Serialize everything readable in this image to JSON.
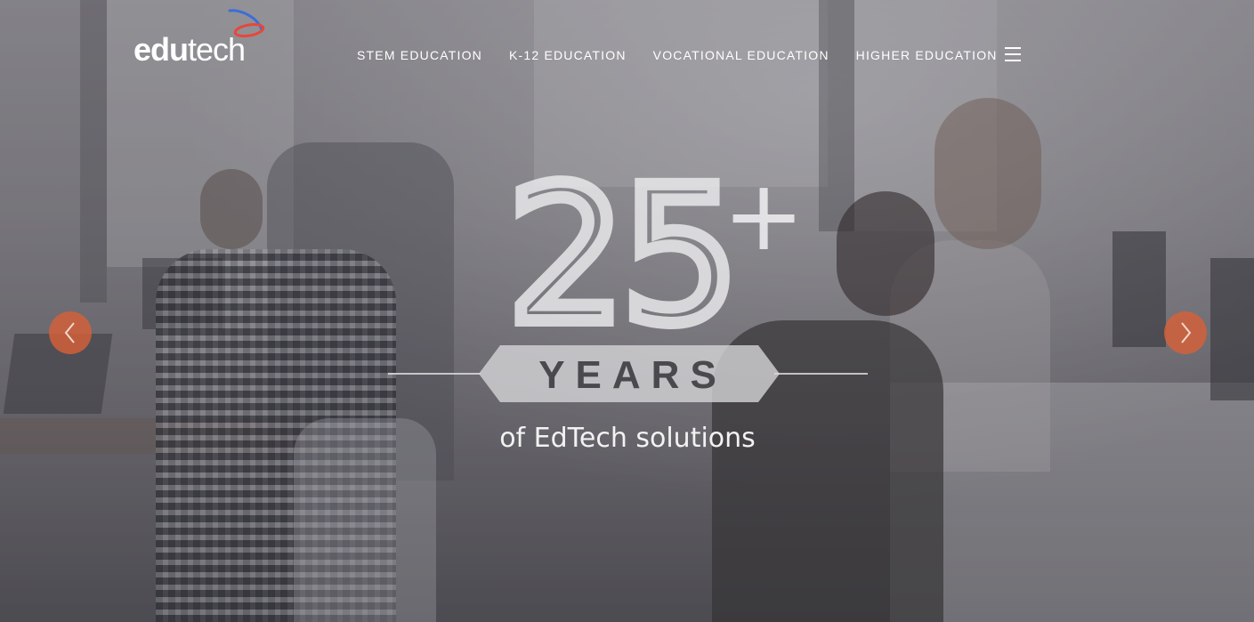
{
  "logo": {
    "text_bold": "edu",
    "text_regular": "tech",
    "swoosh_colors": [
      "#e8473a",
      "#3a6fd8"
    ]
  },
  "nav": {
    "items": [
      {
        "label": "STEM EDUCATION"
      },
      {
        "label": "K-12 EDUCATION"
      },
      {
        "label": "VOCATIONAL EDUCATION"
      },
      {
        "label": "HIGHER EDUCATION"
      }
    ],
    "menu_icon": "hamburger-icon"
  },
  "hero": {
    "big_number": "25",
    "plus_sign": "+",
    "years_label": "YEARS",
    "subtitle": "of EdTech solutions"
  },
  "carousel": {
    "prev_icon": "chevron-left-icon",
    "next_icon": "chevron-right-icon",
    "accent_color": "#d66038"
  }
}
